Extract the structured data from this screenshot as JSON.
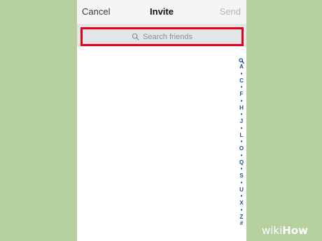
{
  "navbar": {
    "cancel_label": "Cancel",
    "title": "Invite",
    "send_label": "Send"
  },
  "search": {
    "placeholder": "Search friends",
    "icon": "search-icon",
    "highlight_color": "#e3001b"
  },
  "index": [
    "search",
    "A",
    "•",
    "C",
    "•",
    "F",
    "•",
    "H",
    "•",
    "J",
    "•",
    "L",
    "•",
    "O",
    "•",
    "Q",
    "•",
    "S",
    "•",
    "U",
    "•",
    "X",
    "•",
    "Z",
    "#"
  ],
  "watermark": {
    "wiki": "wiki",
    "how": "How"
  },
  "colors": {
    "background": "#b5cf9f",
    "accent": "#1a4e9c",
    "send_disabled": "#b4b4b8"
  }
}
